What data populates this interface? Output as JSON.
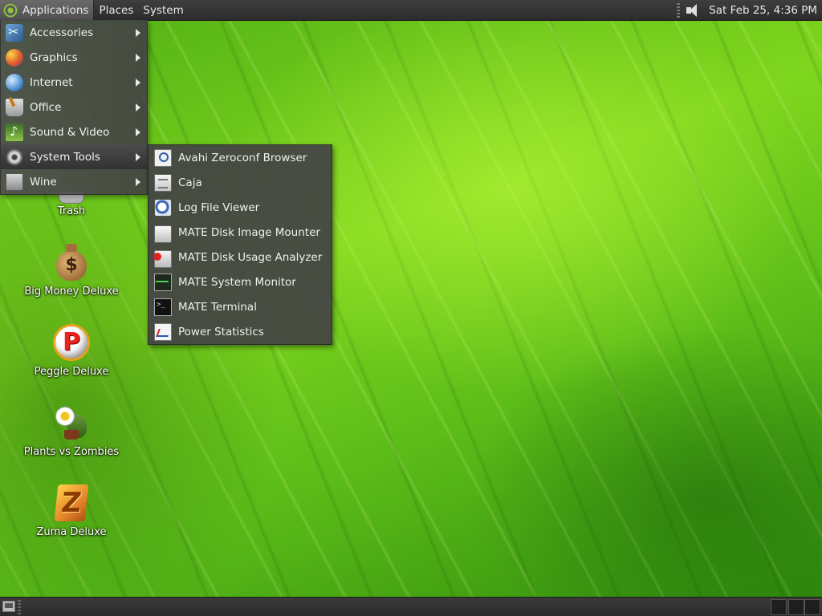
{
  "top_panel": {
    "menus": [
      "Applications",
      "Places",
      "System"
    ],
    "clock": "Sat Feb 25,  4:36 PM"
  },
  "applications_menu": {
    "items": [
      {
        "label": "Accessories",
        "icon": "accessories-icon"
      },
      {
        "label": "Graphics",
        "icon": "graphics-icon"
      },
      {
        "label": "Internet",
        "icon": "internet-icon"
      },
      {
        "label": "Office",
        "icon": "office-icon"
      },
      {
        "label": "Sound & Video",
        "icon": "sound-video-icon"
      },
      {
        "label": "System Tools",
        "icon": "system-tools-icon",
        "active": true
      },
      {
        "label": "Wine",
        "icon": "wine-icon"
      }
    ]
  },
  "system_tools_submenu": {
    "items": [
      {
        "label": "Avahi Zeroconf Browser",
        "icon": "avahi-icon"
      },
      {
        "label": "Caja",
        "icon": "caja-icon"
      },
      {
        "label": "Log File Viewer",
        "icon": "log-viewer-icon"
      },
      {
        "label": "MATE Disk Image Mounter",
        "icon": "disk-image-icon"
      },
      {
        "label": "MATE Disk Usage Analyzer",
        "icon": "disk-usage-icon"
      },
      {
        "label": "MATE System Monitor",
        "icon": "system-monitor-icon"
      },
      {
        "label": "MATE Terminal",
        "icon": "terminal-icon"
      },
      {
        "label": "Power Statistics",
        "icon": "power-statistics-icon"
      }
    ]
  },
  "desktop_icons": [
    {
      "label": "Trash",
      "icon": "trash-icon"
    },
    {
      "label": "Big Money Deluxe",
      "icon": "money-bag-icon"
    },
    {
      "label": "Peggle Deluxe",
      "icon": "peggle-icon"
    },
    {
      "label": "Plants vs Zombies",
      "icon": "plants-vs-zombies-icon"
    },
    {
      "label": "Zuma Deluxe",
      "icon": "zuma-icon"
    }
  ]
}
